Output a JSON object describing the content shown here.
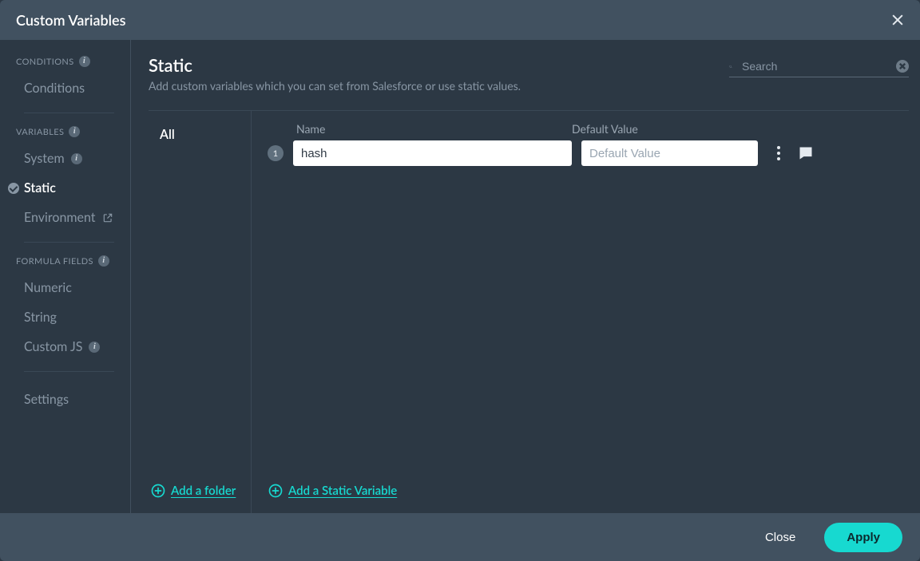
{
  "header": {
    "title": "Custom Variables"
  },
  "sidebar": {
    "sections": {
      "conditions": {
        "label": "CONDITIONS",
        "items": [
          {
            "label": "Conditions"
          }
        ]
      },
      "variables": {
        "label": "VARIABLES",
        "items": [
          {
            "label": "System"
          },
          {
            "label": "Static"
          },
          {
            "label": "Environment"
          }
        ]
      },
      "formula": {
        "label": "FORMULA FIELDS",
        "items": [
          {
            "label": "Numeric"
          },
          {
            "label": "String"
          },
          {
            "label": "Custom JS"
          }
        ]
      },
      "settings": {
        "items": [
          {
            "label": "Settings"
          }
        ]
      }
    }
  },
  "main": {
    "heading": "Static",
    "subheading": "Add custom variables which you can set from Salesforce or use static values.",
    "search_placeholder": "Search",
    "folders": {
      "all_label": "All",
      "add_folder_label": "Add a folder"
    },
    "columns": {
      "name": "Name",
      "default": "Default Value"
    },
    "variables": [
      {
        "index": "1",
        "name": "hash",
        "default": "",
        "default_placeholder": "Default Value"
      }
    ],
    "add_variable_label": "Add a Static Variable"
  },
  "footer": {
    "close": "Close",
    "apply": "Apply"
  }
}
